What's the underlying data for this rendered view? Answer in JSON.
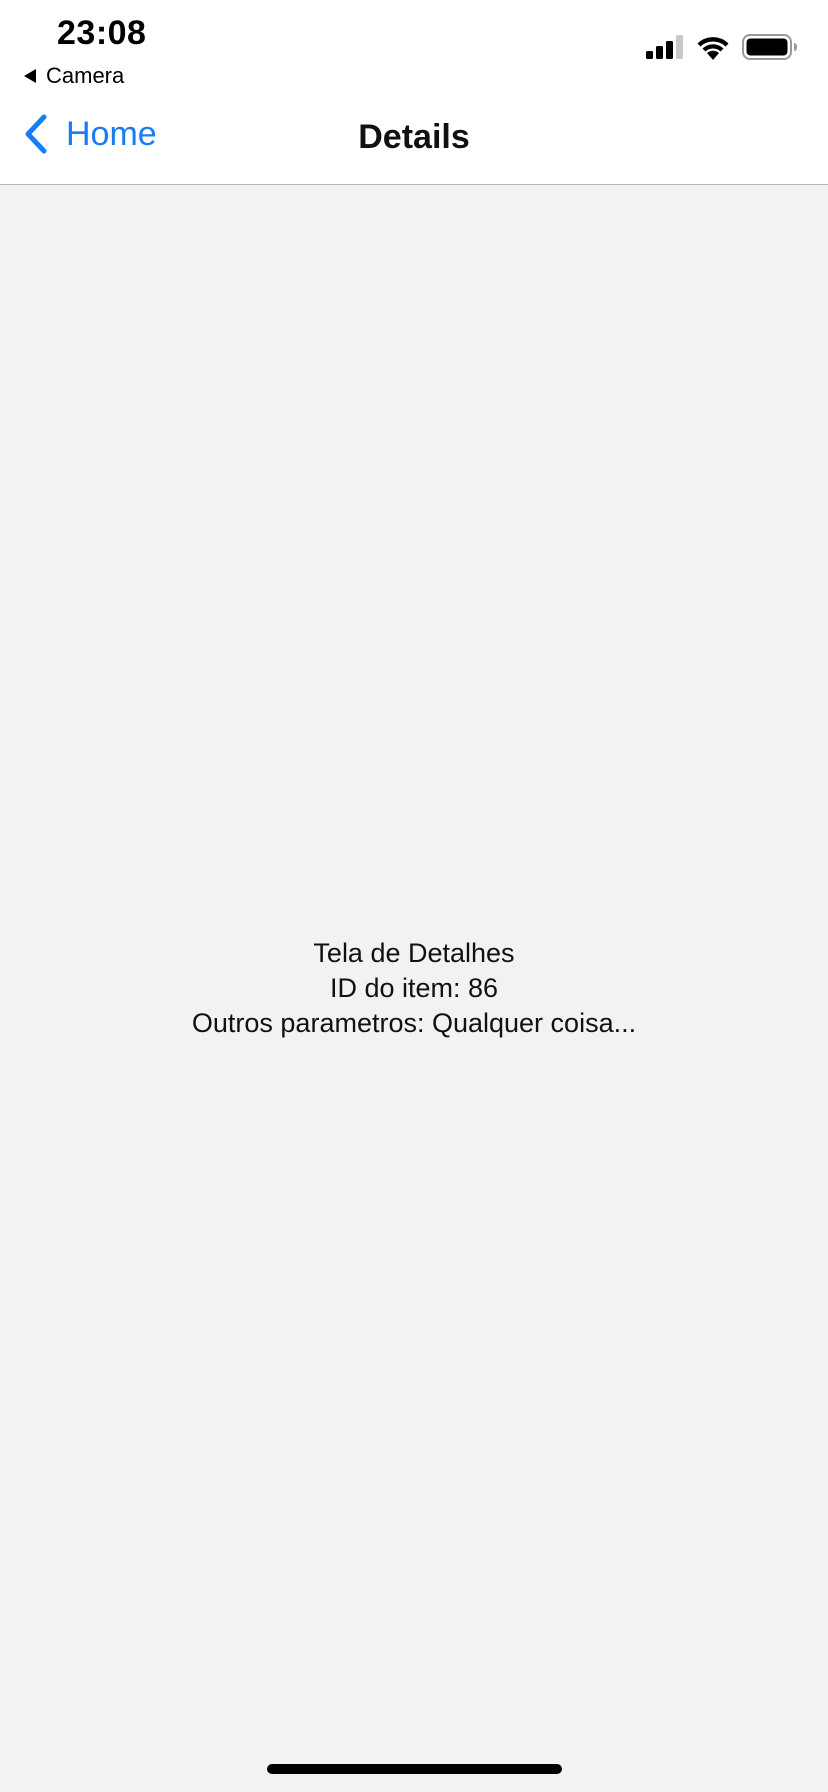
{
  "status_bar": {
    "time": "23:08",
    "back_app_label": "Camera",
    "icons": [
      "cellular-signal-icon",
      "wifi-icon",
      "battery-icon"
    ]
  },
  "nav": {
    "back_label": "Home",
    "title": "Details",
    "accent_color": "#1a7cf2"
  },
  "content": {
    "line1": "Tela de Detalhes",
    "line2": "ID do item: 86",
    "line3": "Outros parametros: Qualquer coisa..."
  }
}
